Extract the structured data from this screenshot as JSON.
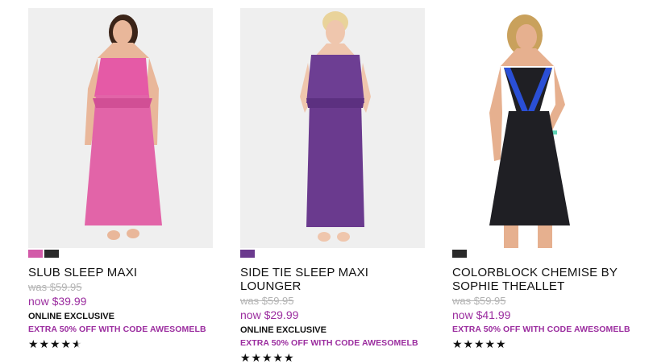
{
  "products": [
    {
      "name": "SLUB SLEEP MAXI",
      "was": "was $59.95",
      "now": "now $39.99",
      "exclusive": "ONLINE EXCLUSIVE",
      "promo": "EXTRA 50% OFF WITH CODE AWESOMELB",
      "swatches": [
        "#d25aa8",
        "#2a2a2a"
      ],
      "rating": 4.5,
      "garment_color": "#e55aa6",
      "garment_icon": "sleep-maxi-dress-image"
    },
    {
      "name": "SIDE TIE SLEEP MAXI LOUNGER",
      "was": "was $59.95",
      "now": "now $29.99",
      "exclusive": "ONLINE EXCLUSIVE",
      "promo": "EXTRA 50% OFF WITH CODE AWESOMELB",
      "swatches": [
        "#6b3a8e"
      ],
      "rating": 5,
      "garment_color": "#6d3e93",
      "garment_icon": "maxi-lounger-image"
    },
    {
      "name": "COLORBLOCK CHEMISE BY SOPHIE THEALLET",
      "was": "was $59.95",
      "now": "now $41.99",
      "exclusive": "",
      "promo": "EXTRA 50% OFF WITH CODE AWESOMELB",
      "swatches": [
        "#2a2a2a"
      ],
      "rating": 5,
      "garment_color": "#1f1f24",
      "garment_icon": "chemise-image"
    }
  ],
  "accent": "#9b2d9f"
}
